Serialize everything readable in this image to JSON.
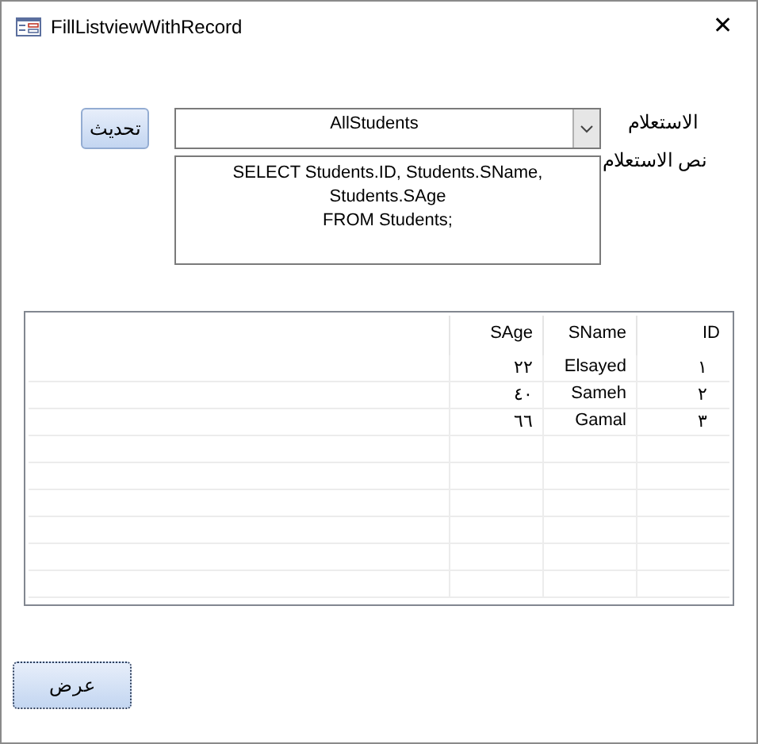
{
  "window": {
    "title": "FillListviewWithRecord",
    "close": "✕"
  },
  "query": {
    "label": "الاستعلام",
    "value": "AllStudents"
  },
  "query_text": {
    "label": "نص الاستعلام",
    "lines": [
      "SELECT Students.ID, Students.SName,",
      "Students.SAge",
      "FROM Students;"
    ]
  },
  "refresh_button": {
    "label": "تحديث"
  },
  "list": {
    "columns": [
      "SAge",
      "SName",
      "ID"
    ],
    "rows": [
      [
        "٢٢",
        "Elsayed",
        "١"
      ],
      [
        "٤٠",
        "Sameh",
        "٢"
      ],
      [
        "٦٦",
        "Gamal",
        "٣"
      ]
    ]
  },
  "show_button": {
    "label": "عرض",
    "focused": true
  }
}
